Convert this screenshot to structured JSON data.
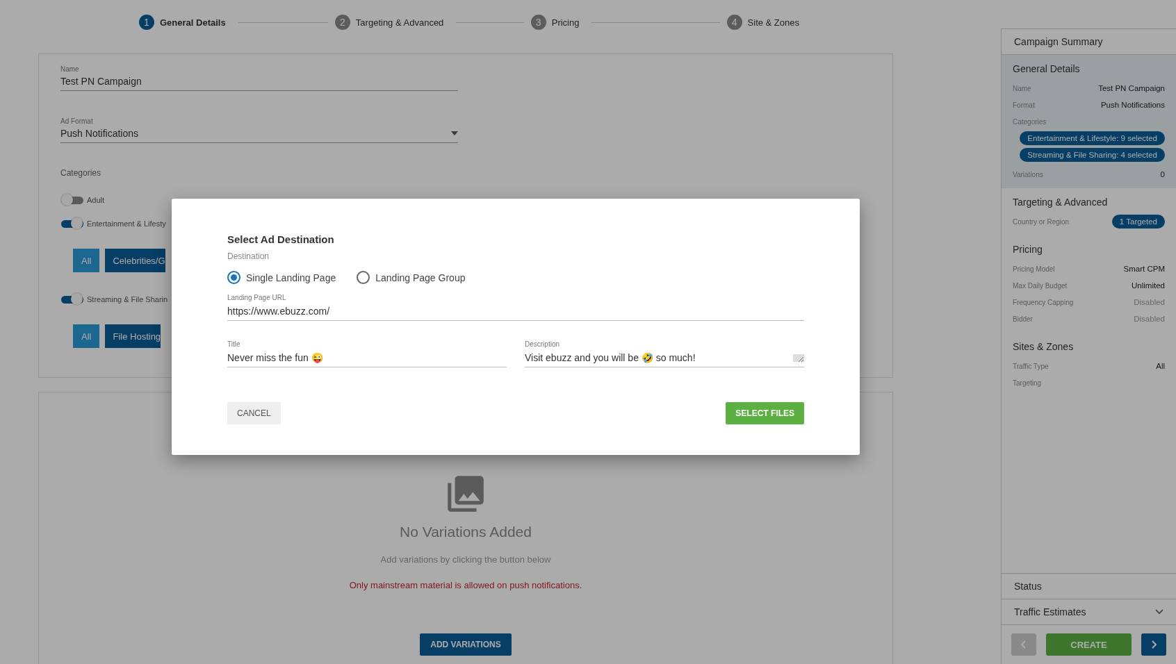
{
  "stepper": [
    {
      "number": "1",
      "label": "General Details",
      "selected": true
    },
    {
      "number": "2",
      "label": "Targeting & Advanced",
      "selected": false
    },
    {
      "number": "3",
      "label": "Pricing",
      "selected": false
    },
    {
      "number": "4",
      "label": "Site & Zones",
      "selected": false
    }
  ],
  "form": {
    "name": {
      "label": "Name",
      "value": "Test PN Campaign"
    },
    "ad_format": {
      "label": "Ad Format",
      "value": "Push Notifications"
    },
    "categories": {
      "label": "Categories",
      "items": [
        {
          "label": "Adult",
          "on": false
        },
        {
          "label": "Entertainment & Lifesty",
          "on": true,
          "chips": [
            {
              "label": "All",
              "kind": "all"
            },
            {
              "label": "Celebrities/G",
              "kind": "category"
            }
          ]
        },
        {
          "label": "Streaming & File Sharin",
          "on": true,
          "chips": [
            {
              "label": "All",
              "kind": "all"
            },
            {
              "label": "File Hosting",
              "kind": "category"
            }
          ]
        }
      ]
    }
  },
  "variations": {
    "title": "No Variations Added",
    "hint": "Add variations by clicking the button below",
    "warning": "Only mainstream material is allowed on push notifications.",
    "button": "ADD VARIATIONS"
  },
  "modal": {
    "title": "Select Ad Destination",
    "destination_label": "Destination",
    "options": [
      {
        "label": "Single Landing Page",
        "selected": true
      },
      {
        "label": "Landing Page Group",
        "selected": false
      }
    ],
    "url": {
      "label": "Landing Page URL",
      "value": "https://www.ebuzz.com/"
    },
    "title_field": {
      "label": "Title",
      "value": "Never miss the fun 😜"
    },
    "description": {
      "label": "Description",
      "value": "Visit ebuzz and you will be 🤣 so much!"
    },
    "cancel": "CANCEL",
    "confirm": "SELECT FILES"
  },
  "summary": {
    "title": "Campaign Summary",
    "sections": [
      {
        "title": "General Details",
        "highlighted": true,
        "rows": [
          {
            "label": "Name",
            "kind": "value",
            "value": "Test PN Campaign"
          },
          {
            "label": "Format",
            "kind": "value",
            "value": "Push Notifications"
          },
          {
            "label": "Categories",
            "kind": "pills",
            "pills": [
              "Entertainment & Lifestyle: 9 selected",
              "Streaming & File Sharing: 4 selected"
            ]
          },
          {
            "label": "Variations",
            "kind": "value",
            "value": "0"
          }
        ]
      },
      {
        "title": "Targeting & Advanced",
        "highlighted": false,
        "rows": [
          {
            "label": "Country or Region",
            "kind": "pill",
            "value": "1 Targeted"
          }
        ]
      },
      {
        "title": "Pricing",
        "highlighted": false,
        "rows": [
          {
            "label": "Pricing Model",
            "kind": "value",
            "value": "Smart CPM"
          },
          {
            "label": "Max Daily Budget",
            "kind": "value",
            "value": "Unlimited"
          },
          {
            "label": "Frequency Capping",
            "kind": "muted",
            "value": "Disabled"
          },
          {
            "label": "Bidder",
            "kind": "muted",
            "value": "Disabled"
          }
        ]
      },
      {
        "title": "Sites & Zones",
        "highlighted": false,
        "rows": [
          {
            "label": "Traffic Type",
            "kind": "value",
            "value": "All"
          },
          {
            "label": "Targeting",
            "kind": "label"
          }
        ]
      }
    ],
    "status": "Status",
    "traffic": {
      "title": "Traffic Estimates",
      "expanded": false
    },
    "footer": {
      "prev_disabled": true,
      "create": "CREATE"
    }
  }
}
